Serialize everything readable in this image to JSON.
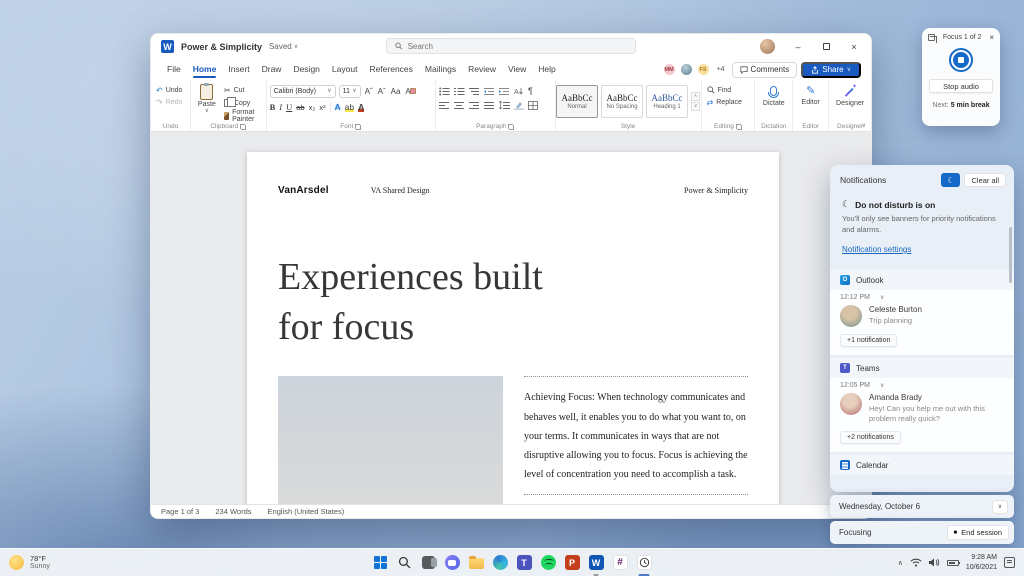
{
  "colors": {
    "word_blue": "#185abd",
    "accent_blue": "#1569c8",
    "heading1_blue": "#2f5496",
    "link_blue": "#1a66c2",
    "teams_purple": "#5059c9",
    "powerpoint_orange": "#c43e1c",
    "spotify_green": "#1ed760",
    "folder_yellow": "#f2b94b",
    "slack_plum": "#611f69"
  },
  "titlebar": {
    "app_title": "Power & Simplicity",
    "saved": "Saved",
    "search_placeholder": "Search"
  },
  "menu": {
    "tabs": [
      "File",
      "Home",
      "Insert",
      "Draw",
      "Design",
      "Layout",
      "References",
      "Mailings",
      "Review",
      "View",
      "Help"
    ],
    "collab1": "MM",
    "collab2": "FS",
    "more_collaborators": "+4",
    "comments": "Comments",
    "share": "Share"
  },
  "ribbon": {
    "undo": "Undo",
    "redo": "Redo",
    "paste": "Paste",
    "cut": "Cut",
    "copy": "Copy",
    "format_painter": "Format Painter",
    "font_name": "Calibri (Body)",
    "font_size": "11",
    "style1_preview": "AaBbCc",
    "style1_name": "Normal",
    "style2_preview": "AaBbCc",
    "style2_name": "No Spacing",
    "style3_preview": "AaBbCc",
    "style3_name": "Heading 1",
    "find": "Find",
    "replace": "Replace",
    "dictate": "Dictate",
    "editor": "Editor",
    "designer": "Designer",
    "captions": {
      "undo": "Undo",
      "clipboard": "Clipboard",
      "font": "Font",
      "paragraph": "Paragraph",
      "style": "Style",
      "editing": "Editing",
      "dictation": "Dictation",
      "editor": "Editor",
      "designer": "Designer"
    }
  },
  "document": {
    "brand": "VanArsdel",
    "subtitle": "VA Shared Design",
    "header_right": "Power & Simplicity",
    "heading": "Experiences built for focus",
    "body": "Achieving Focus: When technology communicates and behaves well, it enables you to do what you want to, on your terms. It communicates in ways that are not disruptive allowing you to focus. Focus is achieving the level of concentration you need to accomplish a task."
  },
  "statusbar": {
    "page": "Page 1 of 3",
    "words": "234 Words",
    "language": "English (United States)"
  },
  "focus_widget": {
    "title": "Focus 1 of 2",
    "stop_audio": "Stop audio",
    "next_label": "Next:",
    "next_value": "5 min break"
  },
  "notifications": {
    "title": "Notifications",
    "clear_all": "Clear all",
    "dnd_title": "Do not disturb is on",
    "dnd_body": "You'll only see banners for priority notifications and alarms.",
    "settings_link": "Notification settings",
    "outlook": {
      "app": "Outlook",
      "time": "12:12 PM",
      "sender": "Celeste Burton",
      "message": "Trip planning",
      "badge": "+1 notification"
    },
    "teams": {
      "app": "Teams",
      "time": "12:05 PM",
      "sender": "Amanda Brady",
      "message": "Hey! Can you help me out with this problem really quick?",
      "badge": "+2 notifications"
    },
    "calendar": {
      "app": "Calendar"
    }
  },
  "date_card": {
    "label": "Wednesday, October 6"
  },
  "session_card": {
    "label": "Focusing",
    "end_button": "End session"
  },
  "taskbar": {
    "weather_temp": "78°F",
    "weather_condition": "Sunny",
    "apps": [
      "start",
      "search",
      "task-view",
      "chat",
      "file-explorer",
      "edge",
      "teams",
      "spotify",
      "powerpoint",
      "word",
      "slack",
      "clock"
    ],
    "time": "9:28 AM",
    "date": "10/6/2021"
  },
  "icons": {
    "minimize": "–",
    "close": "×",
    "chevron_down": "∨",
    "chevron_up": "∧",
    "moon": "☾",
    "scissors": "✂",
    "undo_arrow": "↶",
    "redo_arrow": "↷",
    "pilcrow": "¶",
    "pencil": "✎",
    "swap": "⇄",
    "bold": "B",
    "italic": "I",
    "underline": "U",
    "strike": "ab",
    "subscript": "x₂",
    "superscript": "x²",
    "font_a": "A",
    "grow": "Aˆ",
    "shrink": "Aˇ",
    "case": "Aa",
    "hash": "#",
    "teams_t": "T",
    "ppt_p": "P",
    "word_w": "W",
    "outlook_o": "O",
    "stop_square": "■"
  }
}
